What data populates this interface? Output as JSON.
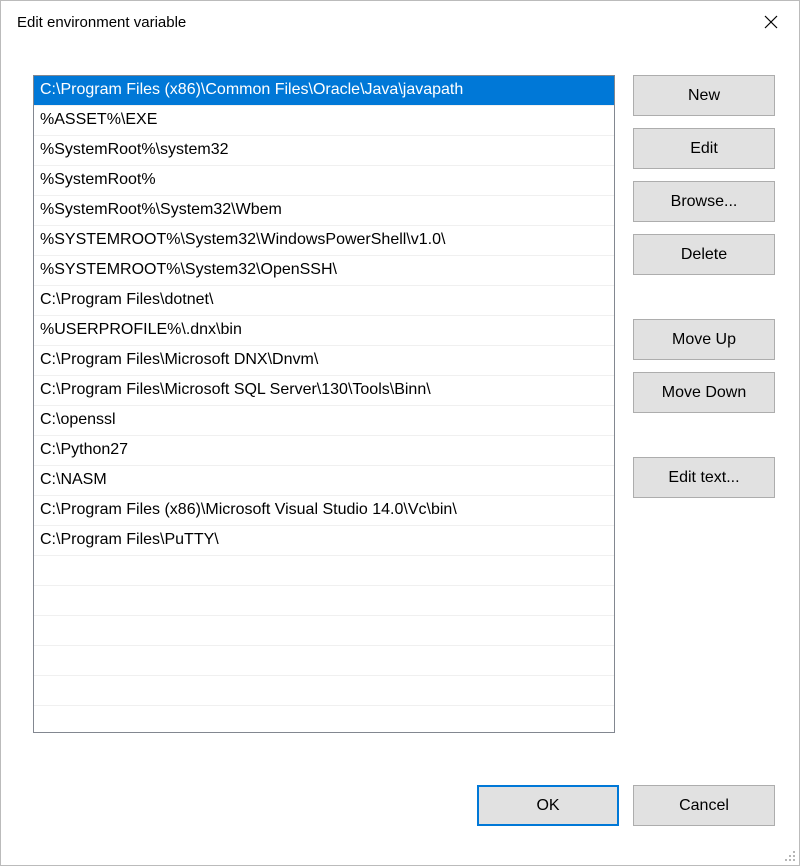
{
  "title": "Edit environment variable",
  "list": {
    "selected_index": 0,
    "items": [
      "C:\\Program Files (x86)\\Common Files\\Oracle\\Java\\javapath",
      "%ASSET%\\EXE",
      "%SystemRoot%\\system32",
      "%SystemRoot%",
      "%SystemRoot%\\System32\\Wbem",
      "%SYSTEMROOT%\\System32\\WindowsPowerShell\\v1.0\\",
      "%SYSTEMROOT%\\System32\\OpenSSH\\",
      "C:\\Program Files\\dotnet\\",
      "%USERPROFILE%\\.dnx\\bin",
      "C:\\Program Files\\Microsoft DNX\\Dnvm\\",
      "C:\\Program Files\\Microsoft SQL Server\\130\\Tools\\Binn\\",
      "C:\\openssl",
      "C:\\Python27",
      "C:\\NASM",
      "C:\\Program Files (x86)\\Microsoft Visual Studio 14.0\\Vc\\bin\\",
      "C:\\Program Files\\PuTTY\\"
    ]
  },
  "buttons": {
    "new": "New",
    "edit": "Edit",
    "browse": "Browse...",
    "delete": "Delete",
    "move_up": "Move Up",
    "move_down": "Move Down",
    "edit_text": "Edit text...",
    "ok": "OK",
    "cancel": "Cancel"
  }
}
